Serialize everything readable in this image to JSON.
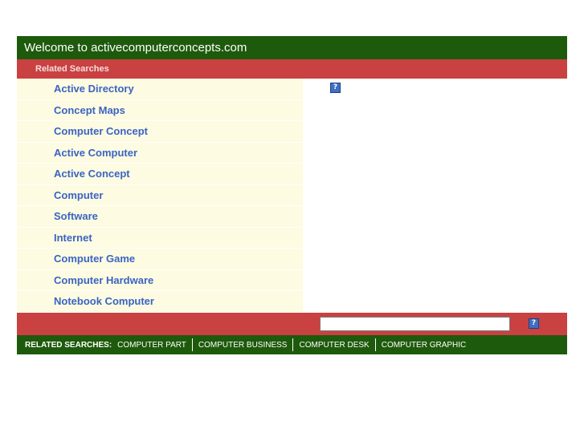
{
  "header": {
    "title": "Welcome to activecomputerconcepts.com"
  },
  "subheader": {
    "title": "Related Searches"
  },
  "links": [
    "Active Directory",
    "Concept Maps",
    "Computer Concept",
    "Active Computer",
    "Active Concept",
    "Computer",
    "Software",
    "Internet",
    "Computer Game",
    "Computer Hardware",
    "Notebook Computer"
  ],
  "help": {
    "glyph": "?"
  },
  "search": {
    "value": "",
    "placeholder": ""
  },
  "footer": {
    "label": "RELATED SEARCHES:",
    "links": [
      "COMPUTER PART",
      "COMPUTER BUSINESS",
      "COMPUTER DESK",
      "COMPUTER GRAPHIC"
    ]
  },
  "colors": {
    "header_green": "#1e5a0c",
    "bar_red": "#c94141",
    "link_blue": "#3a64c4",
    "list_bg": "#fdfbe1"
  }
}
